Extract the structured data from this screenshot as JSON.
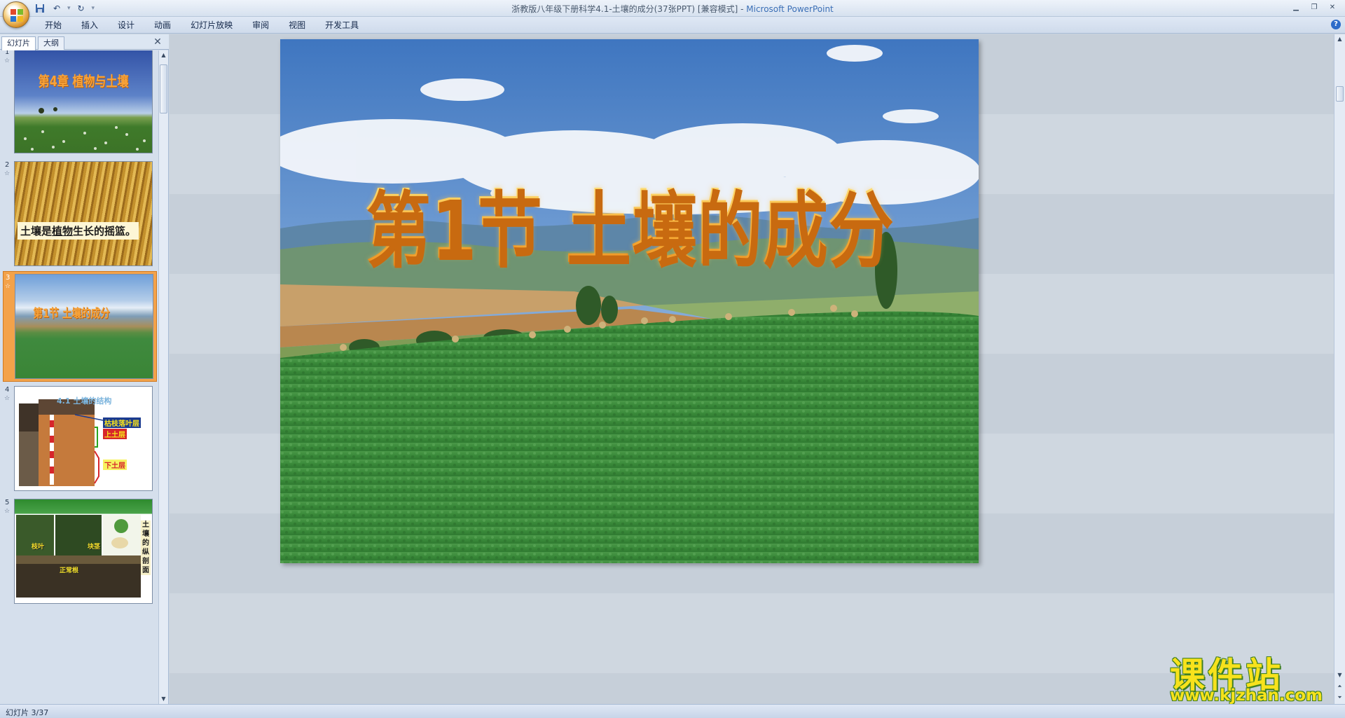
{
  "window": {
    "title": "浙教版八年级下册科学4.1-土壤的成分(37张PPT) [兼容模式]",
    "separator": " - ",
    "app_name": "Microsoft PowerPoint"
  },
  "quick_access": {
    "save_icon": "save-icon",
    "undo_icon": "undo-icon",
    "redo_icon": "redo-icon",
    "customize_icon": "dropdown-icon"
  },
  "ribbon": {
    "tabs": [
      "开始",
      "插入",
      "设计",
      "动画",
      "幻灯片放映",
      "审阅",
      "视图",
      "开发工具"
    ]
  },
  "pane": {
    "tabs": [
      "幻灯片",
      "大纲"
    ],
    "close": "✕"
  },
  "thumbnails": [
    {
      "num": "1",
      "title": "第4章 植物与土壤"
    },
    {
      "num": "2",
      "caption_pre": "土壤是",
      "caption_mid": "植物",
      "caption_post": "生长的摇篮。"
    },
    {
      "num": "3",
      "title": "第1节 土壤的成分"
    },
    {
      "num": "4",
      "heading": "4.1 土壤的结构",
      "label1": "枯枝落叶层",
      "label2": "上土层",
      "label3": "下土层"
    },
    {
      "num": "5",
      "label1": "枝叶",
      "label2": "块茎",
      "label3": "正常根",
      "side": "土壤的纵剖面"
    }
  ],
  "slide": {
    "title": "第1节 土壤的成分"
  },
  "watermark": {
    "title": "课件站",
    "url": "www.kjzhan.com"
  },
  "status": {
    "slide_info": "幻灯片 3/37"
  },
  "colors": {
    "title_orange": "#f6a02e",
    "selected_thumb": "#f3a24a",
    "ribbon_bg": "#dfe8f5",
    "watermark_yellow": "#f7e21c"
  }
}
